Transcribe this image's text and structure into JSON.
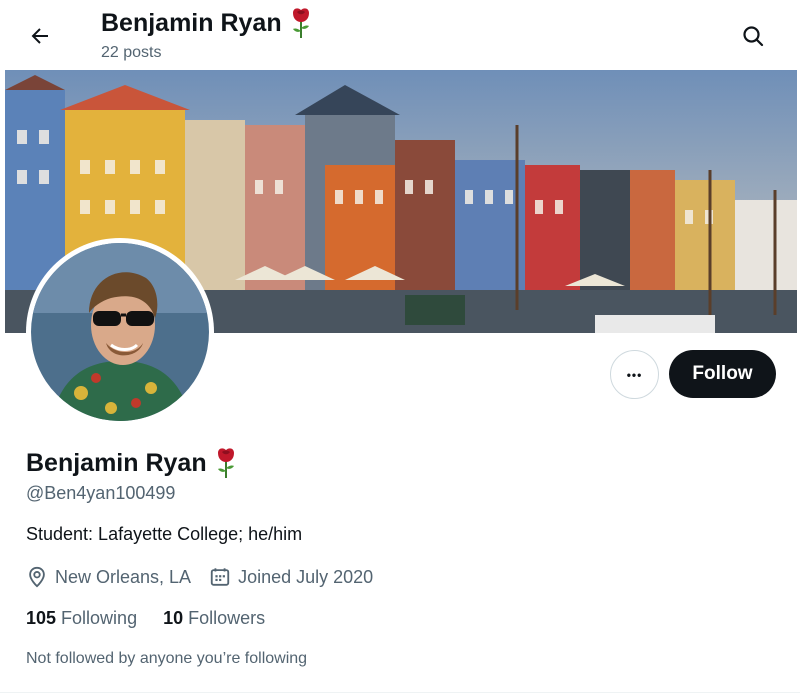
{
  "header": {
    "title": "Benjamin Ryan",
    "posts": "22 posts",
    "back_icon": "arrow-left-icon",
    "search_icon": "search-icon",
    "title_emoji": "rose-icon"
  },
  "profile": {
    "display_name": "Benjamin Ryan",
    "name_emoji": "rose-icon",
    "handle": "@Ben4yan100499",
    "bio": "Student: Lafayette College; he/him",
    "location": "New Orleans, LA",
    "joined": "Joined July 2020",
    "location_icon": "location-pin-icon",
    "calendar_icon": "calendar-icon"
  },
  "actions": {
    "more_label": "•••",
    "follow_label": "Follow"
  },
  "stats": {
    "following_count": "105",
    "following_label": "Following",
    "followers_count": "10",
    "followers_label": "Followers"
  },
  "note": "Not followed by anyone you’re following",
  "colors": {
    "text_primary": "#0f1419",
    "text_secondary": "#536471",
    "follow_bg": "#0f1419",
    "rose": "#c0182b"
  }
}
